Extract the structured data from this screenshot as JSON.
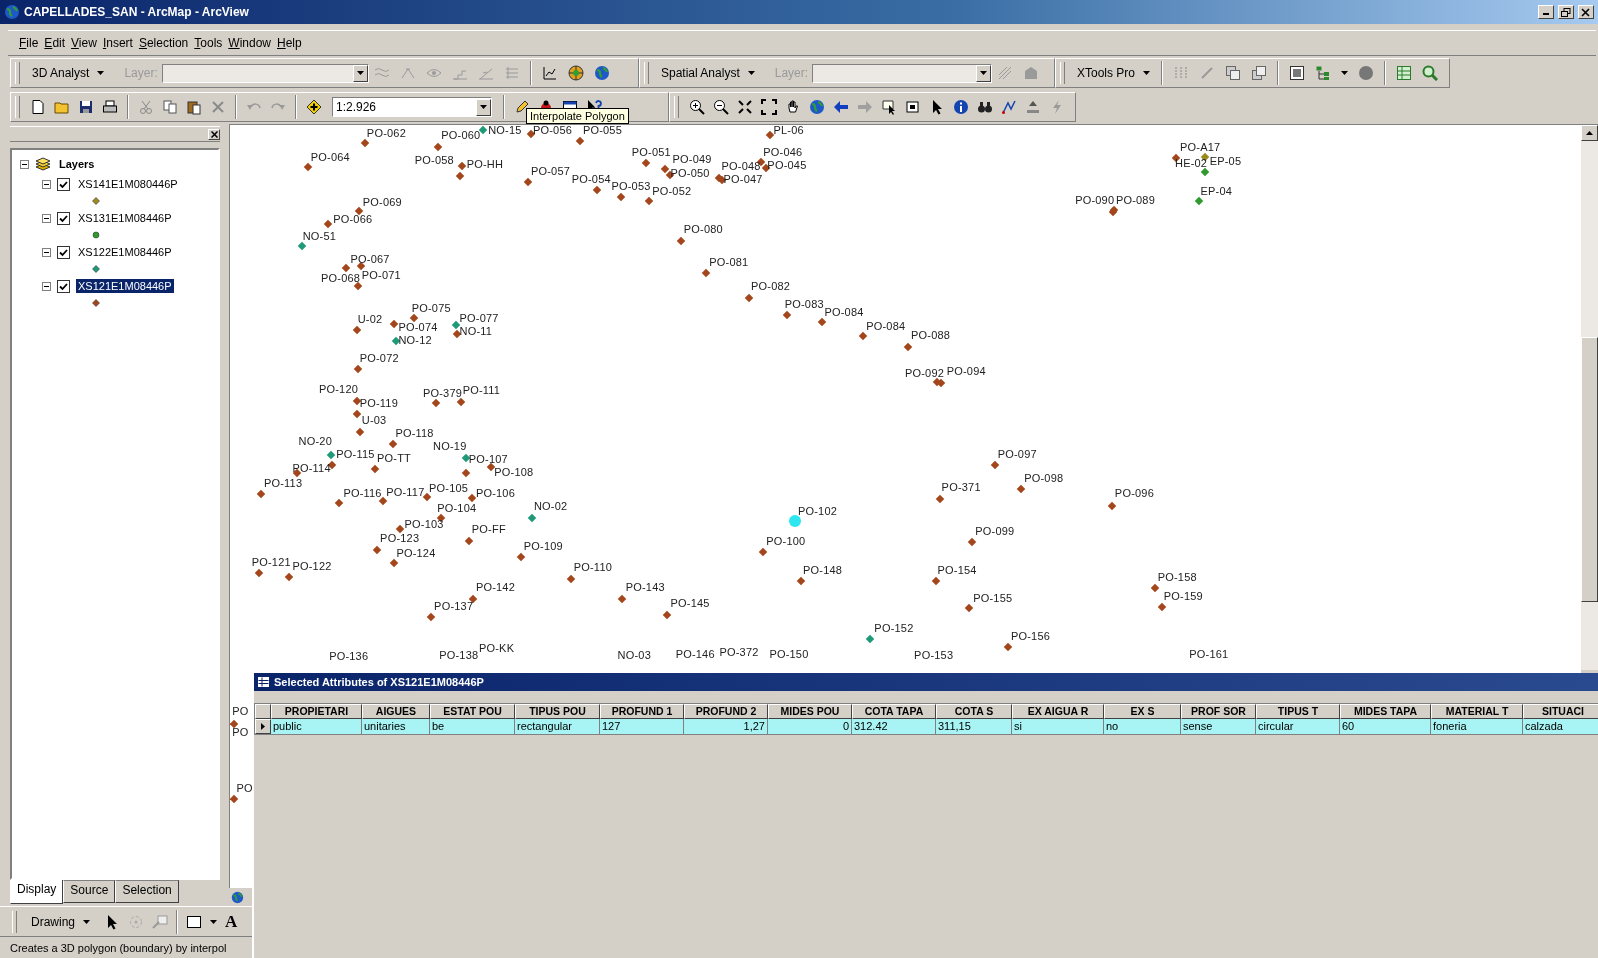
{
  "window": {
    "title": "CAPELLADES_SAN - ArcMap - ArcView"
  },
  "menu": [
    "File",
    "Edit",
    "View",
    "Insert",
    "Selection",
    "Tools",
    "Window",
    "Help"
  ],
  "toolbar_3d": {
    "menu": "3D Analyst",
    "layer_label": "Layer:"
  },
  "toolbar_spatial": {
    "menu": "Spatial Analyst",
    "layer_label": "Layer:"
  },
  "toolbar_xtools": {
    "menu": "XTools Pro"
  },
  "standard_toolbar": {
    "scale": "1:2.926",
    "tooltip": "Interpolate Polygon"
  },
  "toc": {
    "root": {
      "label": "Layers",
      "expanded": true
    },
    "layers": [
      {
        "name": "XS141E1M080446P",
        "checked": true,
        "expanded": true,
        "selected": false,
        "kind": "diamond",
        "color": "#9c8a1e"
      },
      {
        "name": "XS131E1M08446P",
        "checked": true,
        "expanded": true,
        "selected": false,
        "kind": "circle",
        "color": "#2f9a2f"
      },
      {
        "name": "XS122E1M08446P",
        "checked": true,
        "expanded": true,
        "selected": false,
        "kind": "diamond",
        "color": "#1f9a78"
      },
      {
        "name": "XS121E1M08446P",
        "checked": true,
        "expanded": true,
        "selected": true,
        "kind": "diamond",
        "color": "#a3461c"
      }
    ],
    "tabs": [
      {
        "label": "Display",
        "selected": true
      },
      {
        "label": "Source",
        "selected": false
      },
      {
        "label": "Selection",
        "selected": false
      }
    ]
  },
  "map": {
    "points": [
      {
        "label": "PO-062",
        "color": "#a3461c",
        "selected": false
      },
      {
        "label": "PO-060",
        "color": "#a3461c",
        "selected": false
      },
      {
        "label": "NO-15",
        "color": "#1f9a78",
        "selected": false
      },
      {
        "label": "PO-056",
        "color": "#a3461c",
        "selected": false
      },
      {
        "label": "PO-055",
        "color": "#a3461c",
        "selected": false
      },
      {
        "label": "PL-06",
        "color": "#a3461c",
        "selected": false
      },
      {
        "label": "PO-064",
        "color": "#a3461c",
        "selected": false
      },
      {
        "label": "PO-058",
        "color": "#a3461c",
        "selected": false
      },
      {
        "label": "PO-HH",
        "color": "#a3461c",
        "selected": false
      },
      {
        "label": "PO-051",
        "color": "#a3461c",
        "selected": false
      },
      {
        "label": "PO-049",
        "color": "#a3461c",
        "selected": false
      },
      {
        "label": "PO-050",
        "color": "#a3461c",
        "selected": false
      },
      {
        "label": "PO-046",
        "color": "#a3461c",
        "selected": false
      },
      {
        "label": "PO-048",
        "color": "#a3461c",
        "selected": false
      },
      {
        "label": "PO-045",
        "color": "#a3461c",
        "selected": false
      },
      {
        "label": "PO-047",
        "color": "#a3461c",
        "selected": false
      },
      {
        "label": "PO-057",
        "color": "#a3461c",
        "selected": false
      },
      {
        "label": "PO-054",
        "color": "#a3461c",
        "selected": false
      },
      {
        "label": "PO-053",
        "color": "#a3461c",
        "selected": false
      },
      {
        "label": "PO-052",
        "color": "#a3461c",
        "selected": false
      },
      {
        "label": "PO-A17",
        "color": "#a3461c",
        "selected": false
      },
      {
        "label": "HE-02",
        "color": "#9c8a1e",
        "selected": false
      },
      {
        "label": "EP-05",
        "color": "#2f9a2f",
        "selected": false
      },
      {
        "label": "PO-090",
        "color": "#a3461c",
        "selected": false
      },
      {
        "label": "PO-089",
        "color": "#a3461c",
        "selected": false
      },
      {
        "label": "EP-04",
        "color": "#2f9a2f",
        "selected": false
      },
      {
        "label": "PO-069",
        "color": "#a3461c",
        "selected": false
      },
      {
        "label": "PO-066",
        "color": "#a3461c",
        "selected": false
      },
      {
        "label": "NO-51",
        "color": "#1f9a78",
        "selected": false
      },
      {
        "label": "PO-080",
        "color": "#a3461c",
        "selected": false
      },
      {
        "label": "PO-081",
        "color": "#a3461c",
        "selected": false
      },
      {
        "label": "PO-082",
        "color": "#a3461c",
        "selected": false
      },
      {
        "label": "PO-083",
        "color": "#a3461c",
        "selected": false
      },
      {
        "label": "PO-084",
        "color": "#a3461c",
        "selected": false
      },
      {
        "label": "PO-084",
        "color": "#a3461c",
        "selected": false
      },
      {
        "label": "PO-088",
        "color": "#a3461c",
        "selected": false
      },
      {
        "label": "PO-067",
        "color": "#a3461c",
        "selected": false
      },
      {
        "label": "PO-068",
        "color": "#a3461c",
        "selected": false
      },
      {
        "label": "PO-071",
        "color": "#a3461c",
        "selected": false
      },
      {
        "label": "PO-075",
        "color": "#a3461c",
        "selected": false
      },
      {
        "label": "U-02",
        "color": "#a3461c",
        "selected": false
      },
      {
        "label": "PO-077",
        "color": "#1f9a78",
        "selected": false
      },
      {
        "label": "PO-074",
        "color": "#a3461c",
        "selected": false
      },
      {
        "label": "NO-11",
        "color": "#a3461c",
        "selected": false
      },
      {
        "label": "NO-12",
        "color": "#1f9a78",
        "selected": false
      },
      {
        "label": "PO-072",
        "color": "#a3461c",
        "selected": false
      },
      {
        "label": "PO-092",
        "color": "#a3461c",
        "selected": false
      },
      {
        "label": "PO-094",
        "color": "#a3461c",
        "selected": false
      },
      {
        "label": "PO-120",
        "color": "#a3461c",
        "selected": false
      },
      {
        "label": "PO-379",
        "color": "#a3461c",
        "selected": false
      },
      {
        "label": "PO-111",
        "color": "#a3461c",
        "selected": false
      },
      {
        "label": "PO-119",
        "color": "#a3461c",
        "selected": false
      },
      {
        "label": "U-03",
        "color": "#a3461c",
        "selected": false
      },
      {
        "label": "PO-118",
        "color": "#a3461c",
        "selected": false
      },
      {
        "label": "NO-20",
        "color": "#1f9a78",
        "selected": false
      },
      {
        "label": "PO-115",
        "color": "#a3461c",
        "selected": false
      },
      {
        "label": "PO-TT",
        "color": "#a3461c",
        "selected": false
      },
      {
        "label": "NO-19",
        "color": "#1f9a78",
        "selected": false
      },
      {
        "label": "PO-107",
        "color": "#a3461c",
        "selected": false
      },
      {
        "label": "PO-108",
        "color": "#a3461c",
        "selected": false
      },
      {
        "label": "PO-114",
        "color": "#a3461c",
        "selected": false
      },
      {
        "label": "PO-113",
        "color": "#a3461c",
        "selected": false
      },
      {
        "label": "PO-116",
        "color": "#a3461c",
        "selected": false
      },
      {
        "label": "PO-117",
        "color": "#a3461c",
        "selected": false
      },
      {
        "label": "PO-105",
        "color": "#a3461c",
        "selected": false
      },
      {
        "label": "PO-106",
        "color": "#a3461c",
        "selected": false
      },
      {
        "label": "PO-104",
        "color": "#a3461c",
        "selected": false
      },
      {
        "label": "NO-02",
        "color": "#1f9a78",
        "selected": false
      },
      {
        "label": "PO-097",
        "color": "#a3461c",
        "selected": false
      },
      {
        "label": "PO-098",
        "color": "#a3461c",
        "selected": false
      },
      {
        "label": "PO-371",
        "color": "#a3461c",
        "selected": false
      },
      {
        "label": "PO-096",
        "color": "#a3461c",
        "selected": false
      },
      {
        "label": "PO-102",
        "color": "#2ee6f0",
        "selected": true
      },
      {
        "label": "PO-099",
        "color": "#a3461c",
        "selected": false
      },
      {
        "label": "PO-103",
        "color": "#a3461c",
        "selected": false
      },
      {
        "label": "PO-FF",
        "color": "#a3461c",
        "selected": false
      },
      {
        "label": "PO-123",
        "color": "#a3461c",
        "selected": false
      },
      {
        "label": "PO-124",
        "color": "#a3461c",
        "selected": false
      },
      {
        "label": "PO-109",
        "color": "#a3461c",
        "selected": false
      },
      {
        "label": "PO-100",
        "color": "#a3461c",
        "selected": false
      },
      {
        "label": "PO-121",
        "color": "#a3461c",
        "selected": false
      },
      {
        "label": "PO-122",
        "color": "#a3461c",
        "selected": false
      },
      {
        "label": "PO-110",
        "color": "#a3461c",
        "selected": false
      },
      {
        "label": "PO-148",
        "color": "#a3461c",
        "selected": false
      },
      {
        "label": "PO-154",
        "color": "#a3461c",
        "selected": false
      },
      {
        "label": "PO-158",
        "color": "#a3461c",
        "selected": false
      },
      {
        "label": "PO-159",
        "color": "#a3461c",
        "selected": false
      },
      {
        "label": "PO-142",
        "color": "#a3461c",
        "selected": false
      },
      {
        "label": "PO-143",
        "color": "#a3461c",
        "selected": false
      },
      {
        "label": "PO-155",
        "color": "#a3461c",
        "selected": false
      },
      {
        "label": "PO-137",
        "color": "#a3461c",
        "selected": false
      },
      {
        "label": "PO-145",
        "color": "#a3461c",
        "selected": false
      },
      {
        "label": "PO-152",
        "color": "#1f9a78",
        "selected": false
      },
      {
        "label": "PO-156",
        "color": "#a3461c",
        "selected": false
      },
      {
        "label": "PO-136"
      },
      {
        "label": "PO-138"
      },
      {
        "label": "PO-KK"
      },
      {
        "label": "NO-03"
      },
      {
        "label": "PO-146"
      },
      {
        "label": "PO-372"
      },
      {
        "label": "PO-150"
      },
      {
        "label": "PO-153"
      },
      {
        "label": "PO-161"
      },
      {
        "label": "PO",
        "color": "#a3461c",
        "selected": false
      },
      {
        "label": "PO"
      },
      {
        "label": "PO",
        "color": "#a3461c",
        "selected": false
      }
    ]
  },
  "attributes": {
    "title": "Selected Attributes of XS121E1M08446P",
    "columns": [
      {
        "label": "PROPIETARI",
        "numeric": false
      },
      {
        "label": "AIGUES",
        "numeric": false
      },
      {
        "label": "ESTAT POU",
        "numeric": false
      },
      {
        "label": "TIPUS POU",
        "numeric": false
      },
      {
        "label": "PROFUND 1",
        "numeric": false
      },
      {
        "label": "PROFUND 2",
        "numeric": true
      },
      {
        "label": "MIDES POU",
        "numeric": true
      },
      {
        "label": "COTA TAPA",
        "numeric": false
      },
      {
        "label": "COTA S",
        "numeric": false
      },
      {
        "label": "EX AIGUA R",
        "numeric": false
      },
      {
        "label": "EX S",
        "numeric": false
      },
      {
        "label": "PROF SOR",
        "numeric": false
      },
      {
        "label": "TIPUS T",
        "numeric": false
      },
      {
        "label": "MIDES TAPA",
        "numeric": false
      },
      {
        "label": "MATERIAL T",
        "numeric": false
      },
      {
        "label": "SITUACI",
        "numeric": false
      }
    ],
    "rows": [
      {
        "selected": true,
        "cells": [
          "public",
          "unitaries",
          "be",
          "rectangular",
          "127",
          "1,27",
          "0",
          "312.42",
          "311,15",
          "si",
          "no",
          "sense",
          "circular",
          "60",
          "foneria",
          "calzada"
        ]
      }
    ]
  },
  "drawing_toolbar": {
    "menu": "Drawing",
    "text_tool": "A"
  },
  "status_bar": "Creates a 3D polygon (boundary) by interpol"
}
